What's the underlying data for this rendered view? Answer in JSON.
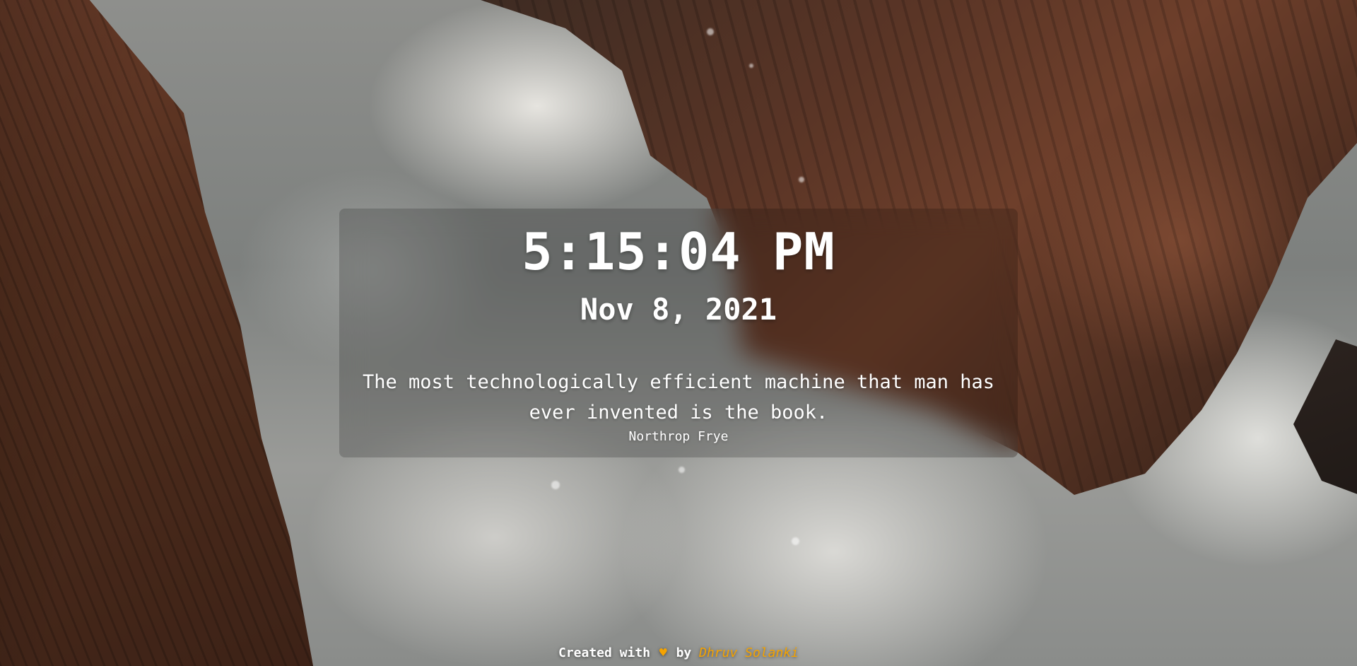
{
  "clock": {
    "time": "5:15:04 PM",
    "date": "Nov 8, 2021"
  },
  "quote": {
    "text": "The most technologically efficient machine that man has ever invented is the book.",
    "author": "Northrop Frye"
  },
  "footer": {
    "prefix": "Created with",
    "heart_icon": "heart-icon",
    "heart_glyph": "♥",
    "by": "by",
    "author_name": "Dhruv Solanki"
  },
  "colors": {
    "accent": "#f5a300",
    "text": "#ffffff"
  }
}
